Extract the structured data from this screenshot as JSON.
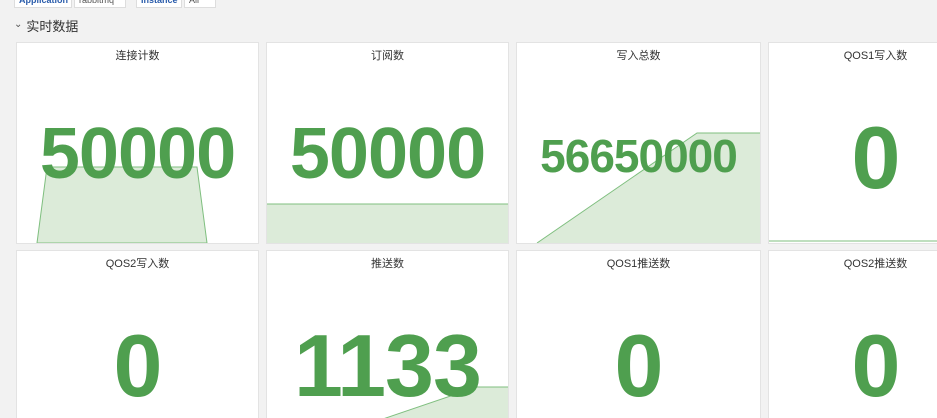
{
  "variables": {
    "application_label": "Application",
    "application_value": "rabbitmq",
    "instance_label": "Instance",
    "instance_value": "All"
  },
  "row": {
    "chevron": "›",
    "title": "实时数据"
  },
  "colors": {
    "value": "#4f9f4f",
    "spark_fill": "#dcebd9",
    "spark_line": "#7fbf7f"
  },
  "panels": [
    {
      "title": "连接计数",
      "value": "50000"
    },
    {
      "title": "订阅数",
      "value": "50000"
    },
    {
      "title": "写入总数",
      "value": "56650000"
    },
    {
      "title": "QOS1写入数",
      "value": "0"
    },
    {
      "title": "QOS2写入数",
      "value": "0"
    },
    {
      "title": "推送数",
      "value": "1133"
    },
    {
      "title": "QOS1推送数",
      "value": "0"
    },
    {
      "title": "QOS2推送数",
      "value": "0"
    }
  ]
}
